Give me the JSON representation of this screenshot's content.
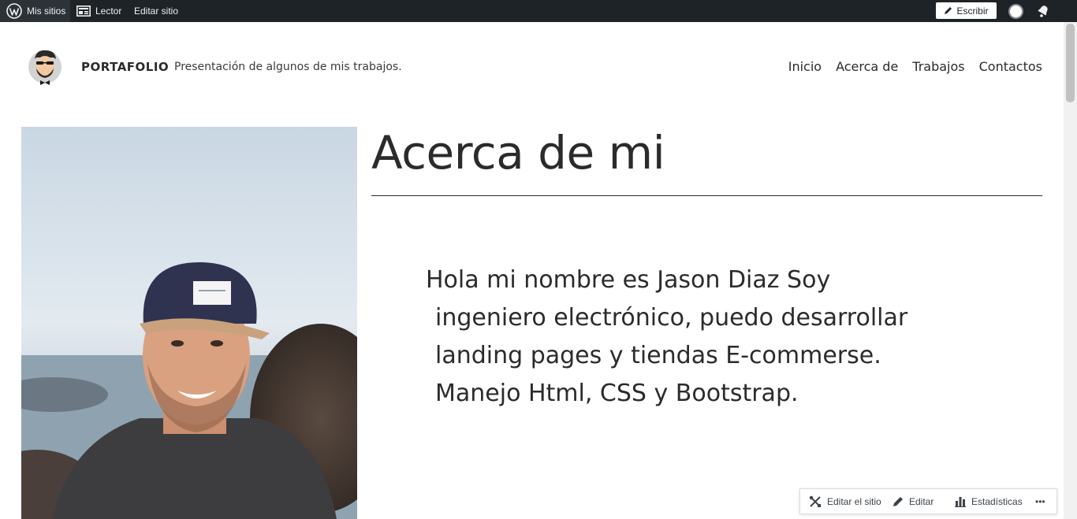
{
  "adminbar": {
    "my_sites": "Mis sitios",
    "reader": "Lector",
    "edit_site": "Editar sitio",
    "write": "Escribir"
  },
  "header": {
    "site_title": "PORTAFOLIO",
    "tagline": "Presentación de algunos de mis trabajos.",
    "nav": [
      "Inicio",
      "Acerca de",
      "Trabajos",
      "Contactos"
    ]
  },
  "main": {
    "heading": "Acerca de mi",
    "bio_lines": [
      "Hola mi nombre es Jason Diaz Soy",
      "ingeniero electrónico, puedo desarrollar",
      "landing pages y tiendas E-commerse.",
      "Manejo Html, CSS y Bootstrap."
    ]
  },
  "floating_toolbar": {
    "edit_site": "Editar el sitio",
    "edit": "Editar",
    "stats": "Estadísticas",
    "more": "•••"
  },
  "icons": {
    "wordpress": "wordpress-icon",
    "reader": "reader-icon",
    "write": "pen-icon",
    "avatar": "avatar-icon",
    "notifications": "bell-icon",
    "tools": "tools-icon",
    "pencil": "pencil-icon",
    "stats": "bar-chart-icon",
    "more": "ellipsis-icon"
  },
  "colors": {
    "adminbar_bg": "#1d2327",
    "text": "#2b2b2b",
    "page_bg": "#ffffff"
  }
}
